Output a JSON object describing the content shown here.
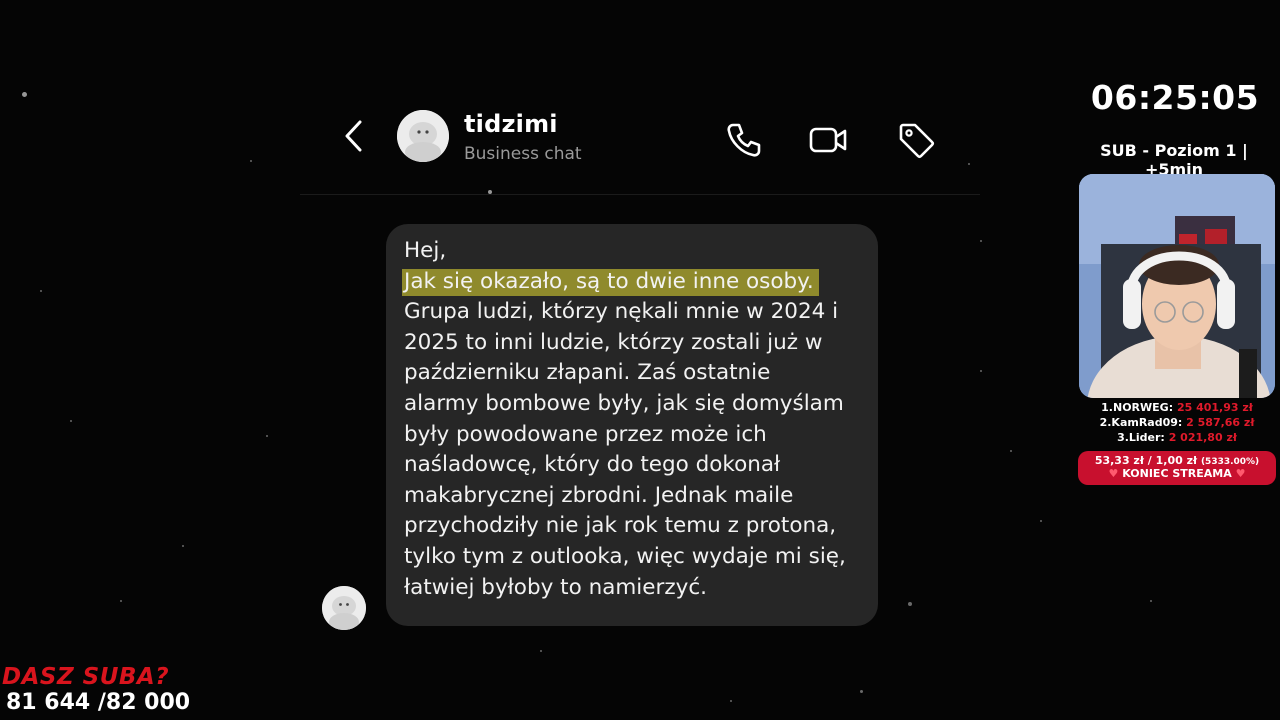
{
  "chat": {
    "contact_name": "tidzimi",
    "contact_subtitle": "Business chat",
    "icons": [
      "back-chevron-icon",
      "phone-icon",
      "video-camera-icon",
      "tag-icon"
    ]
  },
  "message": {
    "lines": [
      "Hej,",
      "Jak się okazało, są to dwie inne osoby.",
      "Grupa ludzi, którzy nękali mnie w 2024 i",
      "2025 to inni ludzie, którzy zostali już w",
      "październiku złapani. Zaś ostatnie",
      "alarmy bombowe były, jak się domyślam",
      "były powodowane przez może ich",
      "naśladowcę, który do tego dokonał",
      "makabrycznej zbrodni. Jednak maile",
      "przychodziły nie jak rok temu z protona,",
      "tylko tym z outlooka, więc wydaje mi się,",
      "łatwiej byłoby to namierzyć."
    ],
    "highlight_color": "#8f8a2c"
  },
  "overlay": {
    "timer": "06:25:05",
    "sub_info": "SUB - Poziom 1 | +5min",
    "donors": [
      {
        "rank": "1.NORWEG:",
        "amount": "25 401,93 zł"
      },
      {
        "rank": "2.KamRad09:",
        "amount": "2 587,66 zł"
      },
      {
        "rank": "3.Lider:",
        "amount": "2 021,80 zł"
      }
    ],
    "goal": {
      "current": "53,33 zł",
      "target": "1,00 zł",
      "percent": "(5333.00%)",
      "label": "KONIEC STREAMA"
    },
    "dasz_suba": "DASZ SUBA?",
    "sub_count": "81 644 /82 000",
    "accent_red": "#d9141d"
  }
}
